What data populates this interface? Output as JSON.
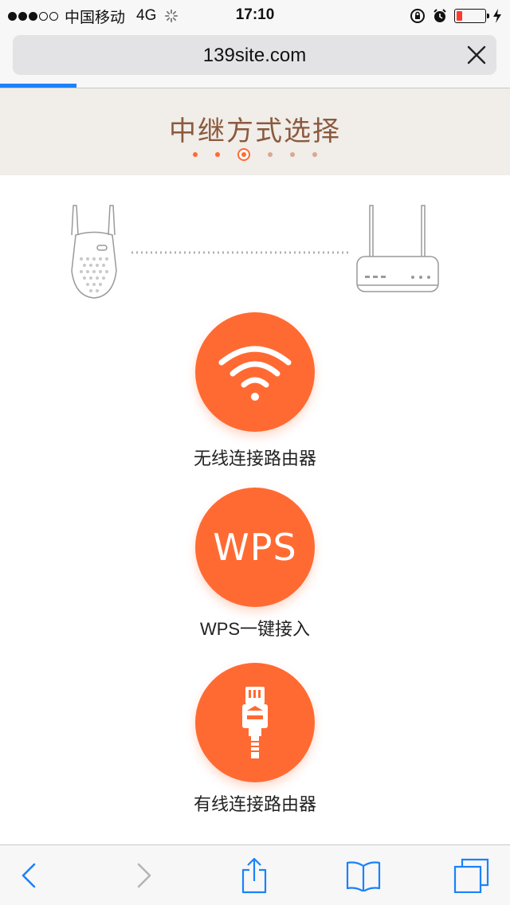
{
  "status_bar": {
    "carrier": "中国移动",
    "network": "4G",
    "time": "17:10",
    "signal_bars_filled": 3,
    "signal_bars_total": 5,
    "battery_level": 0.22,
    "battery_color": "#ff3b30",
    "icons": [
      "activity-spinner-icon",
      "rotation-lock-icon",
      "alarm-icon",
      "battery-icon",
      "charging-bolt-icon"
    ]
  },
  "browser": {
    "url": "139site.com",
    "load_progress": 0.15,
    "progress_color": "#1a82fb"
  },
  "page": {
    "title": "中继方式选择",
    "step_current": 3,
    "step_total": 6,
    "accent_color": "#ff6a33",
    "options": [
      {
        "label": "无线连接路由器",
        "icon": "wifi-icon"
      },
      {
        "label": "WPS一键接入",
        "icon": "wps-icon",
        "icon_text": "WPS"
      },
      {
        "label": "有线连接路由器",
        "icon": "ethernet-cable-icon"
      }
    ]
  },
  "toolbar": {
    "buttons": [
      "back-icon",
      "forward-icon",
      "share-icon",
      "bookmarks-icon",
      "tabs-icon"
    ]
  }
}
